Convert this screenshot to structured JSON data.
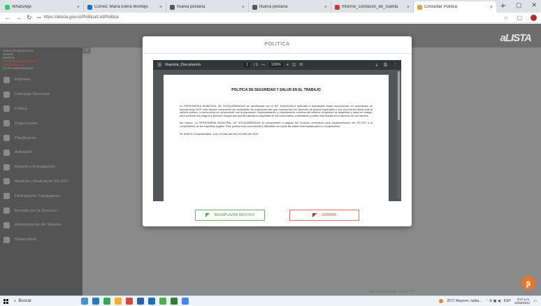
{
  "browser": {
    "tabs": [
      {
        "label": "WhatsApp",
        "color": "#25d366",
        "active": false
      },
      {
        "label": "Correo: Maria Elena Montejo",
        "color": "#0078d4",
        "active": false
      },
      {
        "label": "Nueva pestaña",
        "color": "#555555",
        "active": false
      },
      {
        "label": "Nueva pestaña",
        "color": "#555555",
        "active": false
      },
      {
        "label": "Informe_condicion_de_cuenta",
        "color": "#d32f2f",
        "active": false
      },
      {
        "label": "Consultar Política",
        "color": "#f0a030",
        "active": true
      }
    ],
    "new_tab": "+",
    "url": "https://alissta.gov.co/Politica/List/Politica",
    "window_controls": [
      "–",
      "▢",
      "✕"
    ]
  },
  "app": {
    "logo": "aLISTA",
    "sidebar_header": [
      {
        "text": "SERVICIOS MUNICIPALES",
        "red": false
      },
      {
        "text": "NOMBRE",
        "red": false
      },
      {
        "text": "EMPRESA",
        "red": false
      },
      {
        "text": "PERSONERIA MUNICIPAL DE",
        "red": true
      },
      {
        "text": "DOSQUEBRADAS",
        "red": true
      },
      {
        "text": "SG-SST DOSQUEBRADAS",
        "red": false
      }
    ],
    "sidebar_items": [
      {
        "label": "Empresa",
        "icon": "building-icon"
      },
      {
        "label": "Liderazgo Gerencial",
        "icon": "leadership-icon"
      },
      {
        "label": "Politica",
        "icon": "user-icon"
      },
      {
        "label": "Organización",
        "icon": "org-icon"
      },
      {
        "label": "Planificación",
        "icon": "plan-icon"
      },
      {
        "label": "Aplicación",
        "icon": "apply-icon"
      },
      {
        "label": "Reporte e Investigación",
        "icon": "report-icon"
      },
      {
        "label": "Medición y Evaluación SG-SST",
        "icon": "chart-icon"
      },
      {
        "label": "Participación Trabajadores",
        "icon": "group-icon"
      },
      {
        "label": "Revisión por la Dirección",
        "icon": "review-icon"
      },
      {
        "label": "Administración del Sistema",
        "icon": "admin-icon"
      },
      {
        "label": "Observatorio",
        "icon": "observatory-icon"
      }
    ],
    "footer_text": "Derechos reservados · Version 2024"
  },
  "modal": {
    "title": "POLITICA",
    "viewer": {
      "doc_name": "Reporte_Documento",
      "page_current": "1",
      "page_sep": "/ 1",
      "zoom": "100%",
      "doc_title": "POLITICA DE SEGURIDAD Y SALUD EN EL TRABAJO",
      "paragraphs": [
        "La PERSONERIA MUNICIPAL DE DOSQUEBRADAS se identificada con el NIT 816000158-5 dedicada a actividades estas asociaciones en actividades de asociaciones NCP, esta división comprende las actividades de organizaciones que representan los intereses de grupos especiales o que promueven ideas ante la opinión pública. La personería se compromete con la planeación, implementación y mejoramiento continuo del sistema de gestión de seguridad y salud en trabajo, para controlar los peligros y prevenir riesgos que puedan afectar la seguridad de los funcionarios, contratistas y partes interesadas en el ejercicio de sus labores.",
        "Así mismo, La PERSONERIA MUNICIPAL DE DOSQUEBRADAS se compromete a asignar los recursos necesarios para implementación del SG-SST y el cumplimiento de los requisitos legales. Esta política será comunicada y difundida con todas las partes interesadas para su cumplimiento."
      ],
      "date_line": "Se firma en Dosquebradas, a los 19 días del mes de Abril del 2024."
    },
    "buttons": {
      "replace": "REEMPLAZAR ARCHIVO",
      "close": "CERRAR"
    }
  },
  "taskbar": {
    "search": "Buscar",
    "weather": "25°C Mayorm. nubla...",
    "lang": "ESP",
    "time": "3:57 p.m.",
    "date": "19/06/2024"
  }
}
